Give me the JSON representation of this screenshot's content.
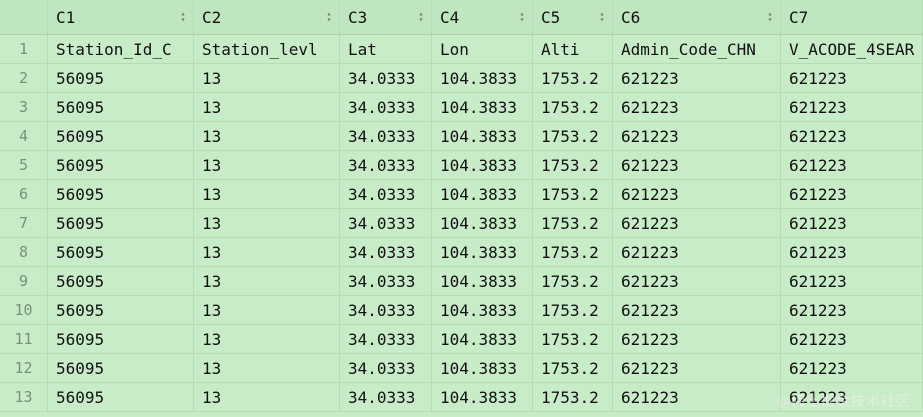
{
  "columns": [
    "C1",
    "C2",
    "C3",
    "C4",
    "C5",
    "C6",
    "C7"
  ],
  "rows": [
    {
      "index": "1",
      "cells": [
        "Station_Id_C",
        "Station_levl",
        "Lat",
        "Lon",
        "Alti",
        "Admin_Code_CHN",
        "V_ACODE_4SEAR"
      ]
    },
    {
      "index": "2",
      "cells": [
        "56095",
        "13",
        "34.0333",
        "104.3833",
        "1753.2",
        "621223",
        "621223"
      ]
    },
    {
      "index": "3",
      "cells": [
        "56095",
        "13",
        "34.0333",
        "104.3833",
        "1753.2",
        "621223",
        "621223"
      ]
    },
    {
      "index": "4",
      "cells": [
        "56095",
        "13",
        "34.0333",
        "104.3833",
        "1753.2",
        "621223",
        "621223"
      ]
    },
    {
      "index": "5",
      "cells": [
        "56095",
        "13",
        "34.0333",
        "104.3833",
        "1753.2",
        "621223",
        "621223"
      ]
    },
    {
      "index": "6",
      "cells": [
        "56095",
        "13",
        "34.0333",
        "104.3833",
        "1753.2",
        "621223",
        "621223"
      ]
    },
    {
      "index": "7",
      "cells": [
        "56095",
        "13",
        "34.0333",
        "104.3833",
        "1753.2",
        "621223",
        "621223"
      ]
    },
    {
      "index": "8",
      "cells": [
        "56095",
        "13",
        "34.0333",
        "104.3833",
        "1753.2",
        "621223",
        "621223"
      ]
    },
    {
      "index": "9",
      "cells": [
        "56095",
        "13",
        "34.0333",
        "104.3833",
        "1753.2",
        "621223",
        "621223"
      ]
    },
    {
      "index": "10",
      "cells": [
        "56095",
        "13",
        "34.0333",
        "104.3833",
        "1753.2",
        "621223",
        "621223"
      ]
    },
    {
      "index": "11",
      "cells": [
        "56095",
        "13",
        "34.0333",
        "104.3833",
        "1753.2",
        "621223",
        "621223"
      ]
    },
    {
      "index": "12",
      "cells": [
        "56095",
        "13",
        "34.0333",
        "104.3833",
        "1753.2",
        "621223",
        "621223"
      ]
    },
    {
      "index": "13",
      "cells": [
        "56095",
        "13",
        "34.0333",
        "104.3833",
        "1753.2",
        "621223",
        "621223"
      ]
    }
  ],
  "watermark": "@稀土掘金技术社区",
  "colors": {
    "background": "#c8ecc8",
    "header_background": "#bfe6c0",
    "grid_line": "#b4dcb5",
    "row_number": "#7a8f7a"
  },
  "icons": {
    "sort": "sort-updown-icon"
  }
}
